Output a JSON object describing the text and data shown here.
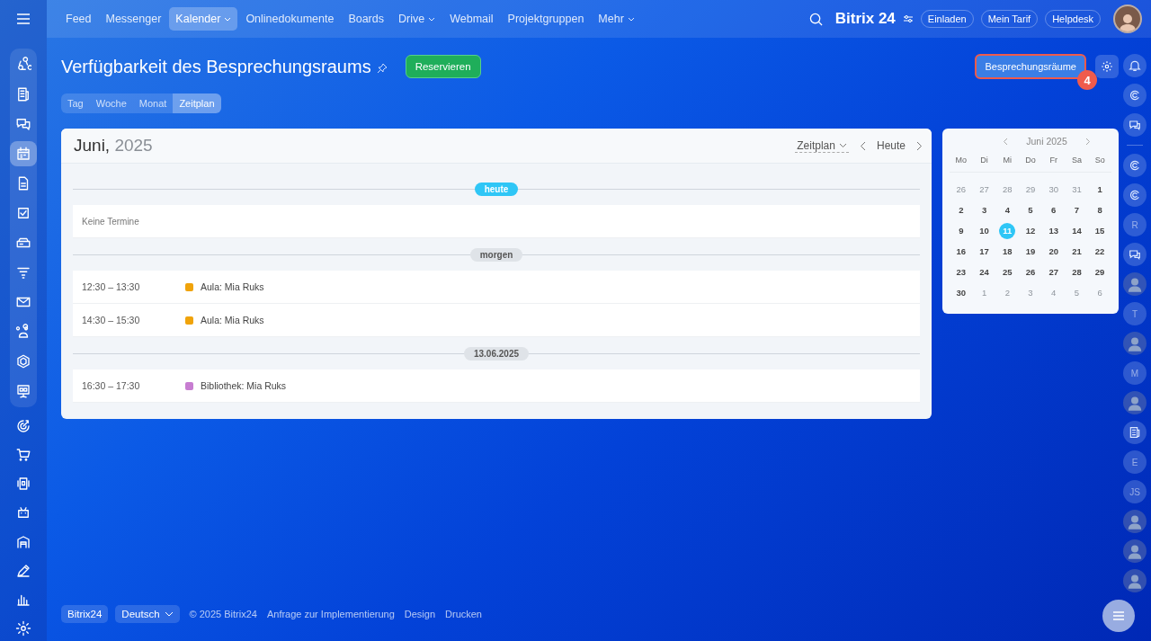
{
  "top_nav": {
    "items": [
      {
        "label": "Feed",
        "selected": false,
        "dropdown": false
      },
      {
        "label": "Messenger",
        "selected": false,
        "dropdown": false
      },
      {
        "label": "Kalender",
        "selected": true,
        "dropdown": true
      },
      {
        "label": "Onlinedokumente",
        "selected": false,
        "dropdown": false
      },
      {
        "label": "Boards",
        "selected": false,
        "dropdown": false
      },
      {
        "label": "Drive",
        "selected": false,
        "dropdown": true
      },
      {
        "label": "Webmail",
        "selected": false,
        "dropdown": false
      },
      {
        "label": "Projektgruppen",
        "selected": false,
        "dropdown": false
      },
      {
        "label": "Mehr",
        "selected": false,
        "dropdown": true
      }
    ],
    "logo": "Bitrix 24",
    "buttons": [
      "Einladen",
      "Mein Tarif",
      "Helpdesk"
    ]
  },
  "left_sidebar": {
    "items": [
      {
        "kind": "loop",
        "selected": false
      },
      {
        "kind": "news",
        "selected": false
      },
      {
        "kind": "chat",
        "selected": false
      },
      {
        "kind": "calendar",
        "selected": true
      },
      {
        "kind": "doc",
        "selected": false
      },
      {
        "kind": "task",
        "selected": false
      },
      {
        "kind": "drive",
        "selected": false
      },
      {
        "kind": "funnel",
        "selected": false
      },
      {
        "kind": "mail",
        "selected": false
      },
      {
        "kind": "people",
        "selected": false
      },
      {
        "kind": "hexagon",
        "selected": false
      },
      {
        "kind": "board",
        "selected": false
      },
      {
        "kind": "target",
        "selected": false
      },
      {
        "kind": "cart",
        "selected": false
      },
      {
        "kind": "phone",
        "selected": false
      },
      {
        "kind": "robot",
        "selected": false
      },
      {
        "kind": "store",
        "selected": false
      },
      {
        "kind": "pen",
        "selected": false
      },
      {
        "kind": "chart",
        "selected": false
      },
      {
        "kind": "gear",
        "selected": false
      }
    ]
  },
  "page": {
    "title": "Verfügbarkeit des Besprechungsraums",
    "reserve_button": "Reservieren",
    "rooms_button": "Besprechungsräume",
    "step_badge": "4"
  },
  "view_tabs": [
    {
      "label": "Tag",
      "selected": false
    },
    {
      "label": "Woche",
      "selected": false
    },
    {
      "label": "Monat",
      "selected": false
    },
    {
      "label": "Zeitplan",
      "selected": true
    }
  ],
  "schedule": {
    "month": "Juni,",
    "year": "2025",
    "view_selector": "Zeitplan",
    "today_button": "Heute",
    "groups": [
      {
        "label": "heute",
        "kind": "today",
        "empty_text": "Keine Termine"
      },
      {
        "label": "morgen",
        "kind": "date",
        "events": [
          {
            "time": "12:30 – 13:30",
            "title": "Aula: Mia Ruks",
            "color": "#f0a30a"
          },
          {
            "time": "14:30 – 15:30",
            "title": "Aula: Mia Ruks",
            "color": "#f0a30a"
          }
        ]
      },
      {
        "label": "13.06.2025",
        "kind": "date",
        "events": [
          {
            "time": "16:30 – 17:30",
            "title": "Bibliothek: Mia Ruks",
            "color": "#c77dd1"
          }
        ]
      }
    ]
  },
  "mini_calendar": {
    "title": "Juni 2025",
    "weekdays": [
      "Mo",
      "Di",
      "Mi",
      "Do",
      "Fr",
      "Sa",
      "So"
    ],
    "days": [
      {
        "label": "26",
        "other_month": true,
        "selected": false
      },
      {
        "label": "27",
        "other_month": true,
        "selected": false
      },
      {
        "label": "28",
        "other_month": true,
        "selected": false
      },
      {
        "label": "29",
        "other_month": true,
        "selected": false
      },
      {
        "label": "30",
        "other_month": true,
        "selected": false
      },
      {
        "label": "31",
        "other_month": true,
        "selected": false
      },
      {
        "label": "1",
        "other_month": false,
        "selected": false
      },
      {
        "label": "2",
        "other_month": false,
        "selected": false
      },
      {
        "label": "3",
        "other_month": false,
        "selected": false
      },
      {
        "label": "4",
        "other_month": false,
        "selected": false
      },
      {
        "label": "5",
        "other_month": false,
        "selected": false
      },
      {
        "label": "6",
        "other_month": false,
        "selected": false
      },
      {
        "label": "7",
        "other_month": false,
        "selected": false
      },
      {
        "label": "8",
        "other_month": false,
        "selected": false
      },
      {
        "label": "9",
        "other_month": false,
        "selected": false
      },
      {
        "label": "10",
        "other_month": false,
        "selected": false
      },
      {
        "label": "11",
        "other_month": false,
        "selected": true
      },
      {
        "label": "12",
        "other_month": false,
        "selected": false
      },
      {
        "label": "13",
        "other_month": false,
        "selected": false
      },
      {
        "label": "14",
        "other_month": false,
        "selected": false
      },
      {
        "label": "15",
        "other_month": false,
        "selected": false
      },
      {
        "label": "16",
        "other_month": false,
        "selected": false
      },
      {
        "label": "17",
        "other_month": false,
        "selected": false
      },
      {
        "label": "18",
        "other_month": false,
        "selected": false
      },
      {
        "label": "19",
        "other_month": false,
        "selected": false
      },
      {
        "label": "20",
        "other_month": false,
        "selected": false
      },
      {
        "label": "21",
        "other_month": false,
        "selected": false
      },
      {
        "label": "22",
        "other_month": false,
        "selected": false
      },
      {
        "label": "23",
        "other_month": false,
        "selected": false
      },
      {
        "label": "24",
        "other_month": false,
        "selected": false
      },
      {
        "label": "25",
        "other_month": false,
        "selected": false
      },
      {
        "label": "26",
        "other_month": false,
        "selected": false
      },
      {
        "label": "27",
        "other_month": false,
        "selected": false
      },
      {
        "label": "28",
        "other_month": false,
        "selected": false
      },
      {
        "label": "29",
        "other_month": false,
        "selected": false
      },
      {
        "label": "30",
        "other_month": false,
        "selected": false
      },
      {
        "label": "1",
        "other_month": true,
        "selected": false
      },
      {
        "label": "2",
        "other_month": true,
        "selected": false
      },
      {
        "label": "3",
        "other_month": true,
        "selected": false
      },
      {
        "label": "4",
        "other_month": true,
        "selected": false
      },
      {
        "label": "5",
        "other_month": true,
        "selected": false
      },
      {
        "label": "6",
        "other_month": true,
        "selected": false
      }
    ]
  },
  "right_sidebar": {
    "items": [
      {
        "kind": "bell"
      },
      {
        "kind": "spiral"
      },
      {
        "kind": "chat"
      },
      {
        "kind": "divider"
      },
      {
        "kind": "spiral"
      },
      {
        "kind": "spiral"
      },
      {
        "kind": "letter",
        "initials": "R"
      },
      {
        "kind": "chat"
      },
      {
        "kind": "photo"
      },
      {
        "kind": "letter",
        "initials": "T"
      },
      {
        "kind": "photo"
      },
      {
        "kind": "letter",
        "initials": "M"
      },
      {
        "kind": "photo"
      },
      {
        "kind": "news"
      },
      {
        "kind": "letter",
        "initials": "E"
      },
      {
        "kind": "letter",
        "initials": "JS"
      },
      {
        "kind": "photo"
      },
      {
        "kind": "photo"
      },
      {
        "kind": "photo"
      }
    ]
  },
  "footer": {
    "logo": "Bitrix24",
    "language": "Deutsch",
    "copyright": "© 2025 Bitrix24",
    "links": [
      "Anfrage zur Implementierung",
      "Design",
      "Drucken"
    ]
  }
}
